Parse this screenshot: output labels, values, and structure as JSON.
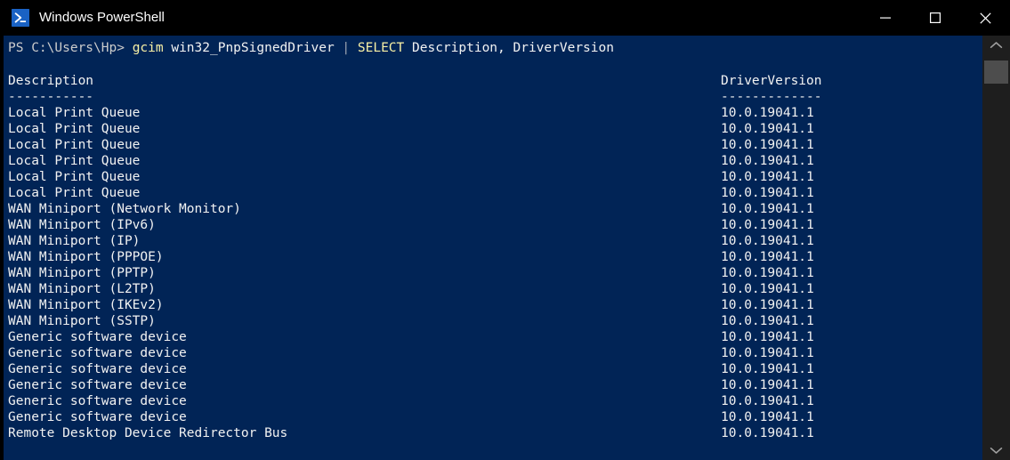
{
  "window": {
    "title": "Windows PowerShell",
    "icon": "powershell-icon",
    "controls": [
      {
        "name": "minimize-button",
        "label": "—"
      },
      {
        "name": "maximize-button",
        "label": "☐"
      },
      {
        "name": "close-button",
        "label": "✕"
      }
    ],
    "colors": {
      "titlebar_bg": "#000000",
      "console_bg": "#012456",
      "text": "#f2f2f2",
      "cmdlet": "#f9f1a5",
      "scrollbar_track": "#1e1e1e",
      "scrollbar_thumb": "#4d4d4d",
      "icon_blue": "#1a62c4"
    }
  },
  "console": {
    "prompt": {
      "prefix": "PS C:\\Users\\Hp>",
      "cmdlet": "gcim",
      "argument": "win32_PnpSignedDriver",
      "pipe": "|",
      "select_keyword": "SELECT",
      "select_properties": "Description, DriverVersion",
      "full_text": "PS C:\\Users\\Hp> gcim win32_PnpSignedDriver | SELECT Description, DriverVersion"
    },
    "table": {
      "headers": {
        "description": "Description",
        "driver_version": "DriverVersion"
      },
      "separators": {
        "description": "-----------",
        "driver_version": "-------------"
      },
      "rows": [
        {
          "description": "Local Print Queue",
          "driver_version": "10.0.19041.1"
        },
        {
          "description": "Local Print Queue",
          "driver_version": "10.0.19041.1"
        },
        {
          "description": "Local Print Queue",
          "driver_version": "10.0.19041.1"
        },
        {
          "description": "Local Print Queue",
          "driver_version": "10.0.19041.1"
        },
        {
          "description": "Local Print Queue",
          "driver_version": "10.0.19041.1"
        },
        {
          "description": "Local Print Queue",
          "driver_version": "10.0.19041.1"
        },
        {
          "description": "WAN Miniport (Network Monitor)",
          "driver_version": "10.0.19041.1"
        },
        {
          "description": "WAN Miniport (IPv6)",
          "driver_version": "10.0.19041.1"
        },
        {
          "description": "WAN Miniport (IP)",
          "driver_version": "10.0.19041.1"
        },
        {
          "description": "WAN Miniport (PPPOE)",
          "driver_version": "10.0.19041.1"
        },
        {
          "description": "WAN Miniport (PPTP)",
          "driver_version": "10.0.19041.1"
        },
        {
          "description": "WAN Miniport (L2TP)",
          "driver_version": "10.0.19041.1"
        },
        {
          "description": "WAN Miniport (IKEv2)",
          "driver_version": "10.0.19041.1"
        },
        {
          "description": "WAN Miniport (SSTP)",
          "driver_version": "10.0.19041.1"
        },
        {
          "description": "Generic software device",
          "driver_version": "10.0.19041.1"
        },
        {
          "description": "Generic software device",
          "driver_version": "10.0.19041.1"
        },
        {
          "description": "Generic software device",
          "driver_version": "10.0.19041.1"
        },
        {
          "description": "Generic software device",
          "driver_version": "10.0.19041.1"
        },
        {
          "description": "Generic software device",
          "driver_version": "10.0.19041.1"
        },
        {
          "description": "Generic software device",
          "driver_version": "10.0.19041.1"
        },
        {
          "description": "Remote Desktop Device Redirector Bus",
          "driver_version": "10.0.19041.1"
        }
      ]
    }
  },
  "scrollbar": {
    "up_arrow": "chevron-up-icon",
    "down_arrow": "chevron-down-icon",
    "thumb": "scrollbar-thumb"
  }
}
